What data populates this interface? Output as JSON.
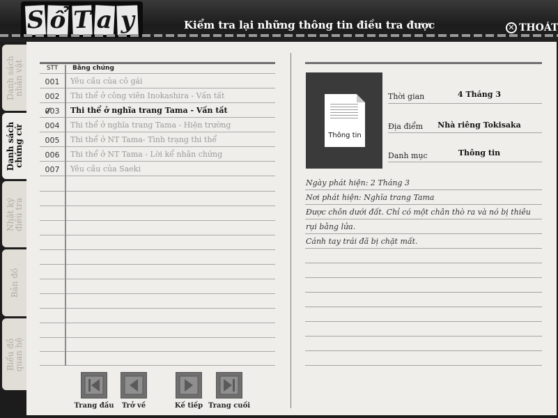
{
  "header": {
    "logo_letters": [
      "S",
      "ổ",
      "T",
      "a",
      "y"
    ],
    "title": "Kiểm tra lại những thông tin điều tra được",
    "exit_label": "THOÁT"
  },
  "tabs": [
    {
      "label": "Danh sách\nnhân vật",
      "active": false
    },
    {
      "label": "Danh sách\nchứng cứ",
      "active": true
    },
    {
      "label": "Nhật ký\nđiều tra",
      "active": false
    },
    {
      "label": "Bản đồ",
      "active": false
    },
    {
      "label": "Biểu đồ\nquan hệ",
      "active": false
    }
  ],
  "evidence": {
    "col_stt": "STT",
    "col_name": "Bằng chứng",
    "rows": [
      {
        "num": "001",
        "name": "Yêu cầu của cô gái",
        "selected": false
      },
      {
        "num": "002",
        "name": "Thi thể ở công viên Inokashira - Vấn tất",
        "selected": false
      },
      {
        "num": "003",
        "name": "Thi thể ở nghĩa trang Tama - Vấn tất",
        "selected": true
      },
      {
        "num": "004",
        "name": "Thi thể ở nghĩa trang Tama - Hiện trường",
        "selected": false
      },
      {
        "num": "005",
        "name": "Thi thể ở NT Tama- Tình trạng thi thể",
        "selected": false
      },
      {
        "num": "006",
        "name": "Thi thể ở NT Tama - Lời kể nhân chứng",
        "selected": false
      },
      {
        "num": "007",
        "name": "Yêu cầu của Saeki",
        "selected": false
      }
    ]
  },
  "nav": {
    "first": "Trang đầu",
    "back": "Trở về",
    "next": "Kế tiếp",
    "last": "Trang cuối"
  },
  "detail": {
    "thumb_caption": "Thông tin",
    "time_label": "Thời gian",
    "time_value": "4 Tháng 3",
    "place_label": "Địa điểm",
    "place_value": "Nhà riêng Tokisaka",
    "category_label": "Danh mục",
    "category_value": "Thông tin",
    "lines": [
      "Ngày phát hiện: 2 Tháng 3",
      "Nơi phát hiện: Nghĩa trang Tama",
      " Được chôn dưới đất. Chỉ có một chân thò ra và nó bị thiêu",
      "rụi bằng lửa.",
      " Cánh tay trái đã bị chặt mất."
    ]
  },
  "colors": {
    "frame": "#1c1c1c",
    "paper": "#efeeea",
    "muted_text": "#9a9a9a",
    "nav_button": "#6f6f6f"
  }
}
